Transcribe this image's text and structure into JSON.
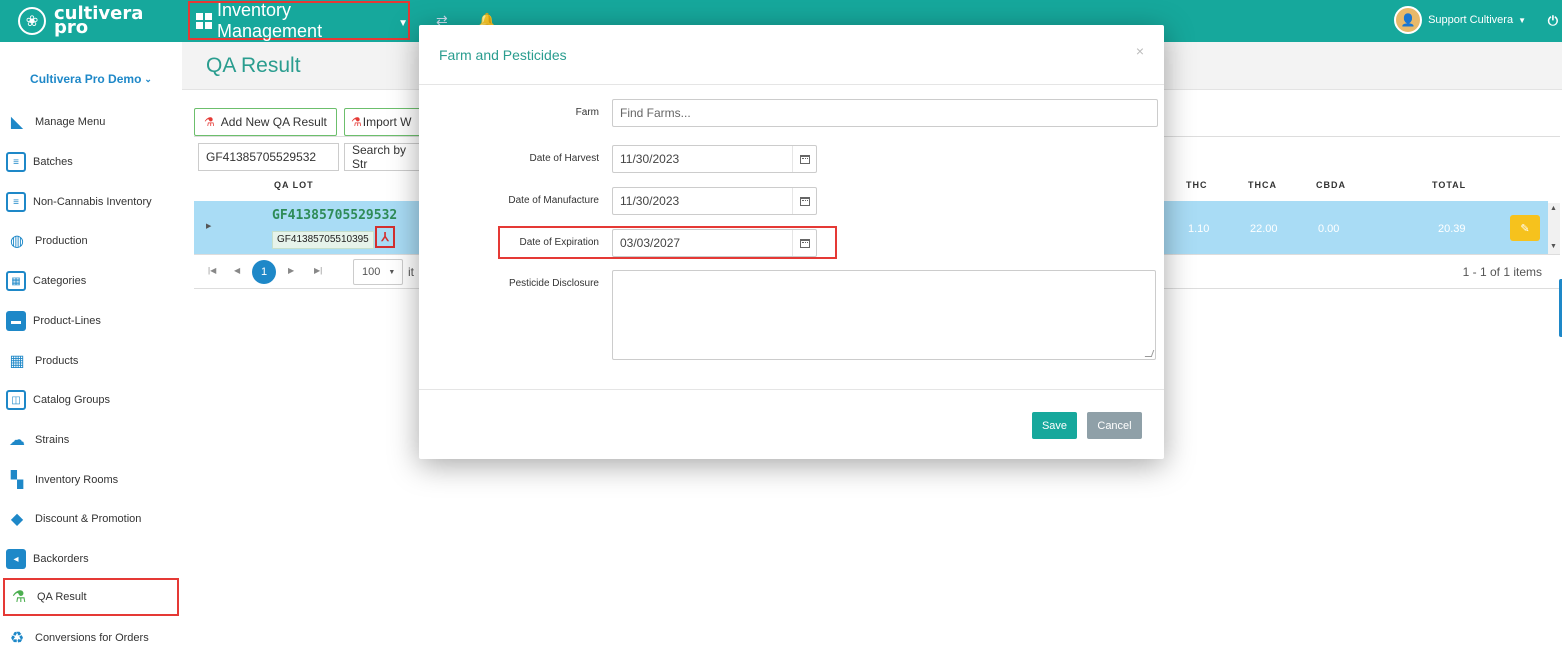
{
  "app": {
    "logo_line1": "cultivera",
    "logo_line2": "pro",
    "module_title": "Inventory Management",
    "user_name": "Support Cultivera"
  },
  "sidebar": {
    "org_name": "Cultivera Pro Demo",
    "items": [
      {
        "label": "Manage Menu",
        "icon": "menu-book-icon"
      },
      {
        "label": "Batches",
        "icon": "batches-icon"
      },
      {
        "label": "Non-Cannabis Inventory",
        "icon": "inventory-icon"
      },
      {
        "label": "Production",
        "icon": "production-icon"
      },
      {
        "label": "Categories",
        "icon": "categories-grid-icon"
      },
      {
        "label": "Product-Lines",
        "icon": "product-lines-icon"
      },
      {
        "label": "Products",
        "icon": "products-grid-icon"
      },
      {
        "label": "Catalog Groups",
        "icon": "catalog-icon"
      },
      {
        "label": "Strains",
        "icon": "strains-icon"
      },
      {
        "label": "Inventory Rooms",
        "icon": "rooms-icon"
      },
      {
        "label": "Discount & Promotion",
        "icon": "tag-icon"
      },
      {
        "label": "Backorders",
        "icon": "backorder-icon"
      },
      {
        "label": "QA Result",
        "icon": "flask-icon"
      },
      {
        "label": "Conversions for Orders",
        "icon": "recycle-icon"
      }
    ]
  },
  "main": {
    "page_title": "QA Result",
    "add_button": "Add New QA Result",
    "import_button": "Import W",
    "search_value": "GF41385705529532",
    "search_placeholder": "Search by Str",
    "columns": {
      "qa_lot": "QA LOT",
      "thc": "THC",
      "thca": "THCA",
      "cbda": "CBDA",
      "total": "TOTAL"
    },
    "row": {
      "qa_lot": "GF41385705529532",
      "badge": "GF41385705510395",
      "thc": "1.10",
      "thca": "22.00",
      "cbda": "0.00",
      "total": "20.39"
    },
    "pager": {
      "current_page": "1",
      "page_size": "100",
      "items_label_fragment": "it",
      "info": "1 - 1 of 1 items"
    }
  },
  "modal": {
    "title": "Farm and Pesticides",
    "close_glyph": "×",
    "farm_label": "Farm",
    "farm_placeholder": "Find Farms...",
    "harvest_label": "Date of Harvest",
    "harvest_value": "11/30/2023",
    "manufacture_label": "Date of Manufacture",
    "manufacture_value": "11/30/2023",
    "expiration_label": "Date of Expiration",
    "expiration_value": "03/03/2027",
    "pesticide_label": "Pesticide Disclosure",
    "save_label": "Save",
    "cancel_label": "Cancel"
  },
  "colors": {
    "topbar": "#16a89c",
    "accent_blue": "#1e88c8",
    "highlight_red": "#e53935",
    "selected_row": "#a9dcf5",
    "edit_yellow": "#f6c21d"
  }
}
